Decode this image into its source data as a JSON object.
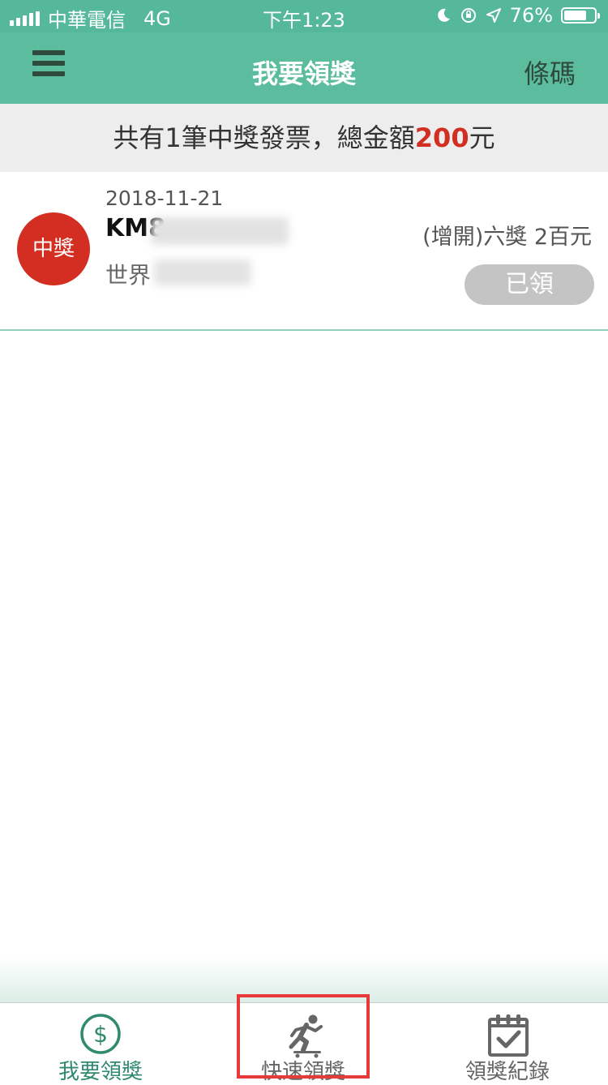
{
  "status_bar": {
    "carrier": "中華電信",
    "network": "4G",
    "time": "下午1:23",
    "battery_percent": "76%",
    "battery_level": 0.76
  },
  "nav": {
    "title": "我要領獎",
    "right_button": "條碼",
    "menu_icon": "hamburger-menu-icon"
  },
  "summary": {
    "prefix": "共有1筆中獎發票，總金額",
    "amount": "200",
    "suffix": "元"
  },
  "items": [
    {
      "badge": "中獎",
      "date": "2018-11-21",
      "invoice_prefix": "KM8",
      "shop_prefix": "世界",
      "prize": "(增開)六獎 2百元",
      "status": "已領"
    }
  ],
  "tabs": [
    {
      "label": "我要領獎",
      "icon": "dollar-circle-icon",
      "active": true
    },
    {
      "label": "快速領獎",
      "icon": "skateboard-runner-icon",
      "active": false
    },
    {
      "label": "領獎紀錄",
      "icon": "calendar-check-icon",
      "active": false
    }
  ],
  "colors": {
    "primary": "#5bbd9d",
    "accent_red": "#d02f21",
    "active_tab": "#2f8a6f",
    "highlight_box": "#e83a3a"
  }
}
